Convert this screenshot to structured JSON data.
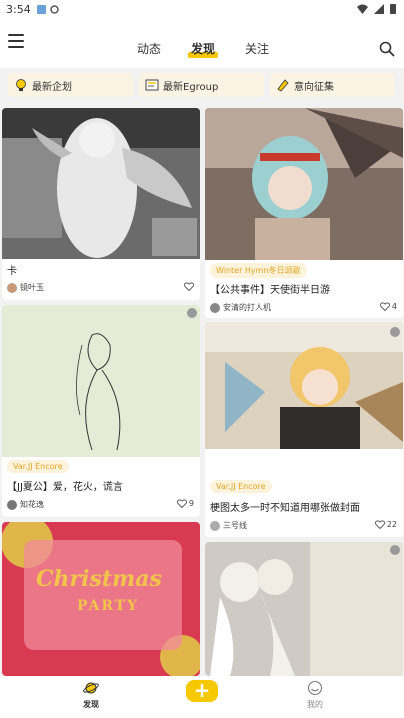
{
  "status_bar": {
    "time": "3:54"
  },
  "header": {
    "tabs": [
      {
        "label": "动态",
        "active": false
      },
      {
        "label": "发现",
        "active": true
      },
      {
        "label": "关注",
        "active": false
      }
    ]
  },
  "categories": [
    {
      "label": "最新企划",
      "icon": "idea-icon"
    },
    {
      "label": "最新Egroup",
      "icon": "group-icon"
    },
    {
      "label": "意向征集",
      "icon": "form-icon"
    }
  ],
  "cards": [
    {
      "title": "卡",
      "author": "镜叶玉",
      "likes": "",
      "tag": ""
    },
    {
      "tag": "Winter Hymn冬日颂歌",
      "title": "【公共事件】天使街半日游",
      "author": "安清的打人机",
      "likes": "4"
    },
    {
      "tag": "Var.JJ Encore",
      "title": "【JJ夏公】爱，花火，谎言",
      "author": "知花逸",
      "likes": "9"
    },
    {
      "tag": "Var.JJ Encore",
      "title": "梗图太多一时不知道用哪张做封面",
      "author": "三号线",
      "likes": "22"
    },
    {
      "image_text_1": "Christmas",
      "image_text_2": "PARTY"
    },
    {
      "title": ""
    }
  ],
  "bottom_nav": {
    "discover_label": "发现",
    "add_label": "+",
    "mine_label": "我的"
  },
  "colors": {
    "accent": "#f6c800",
    "tag_text": "#e3a421"
  }
}
